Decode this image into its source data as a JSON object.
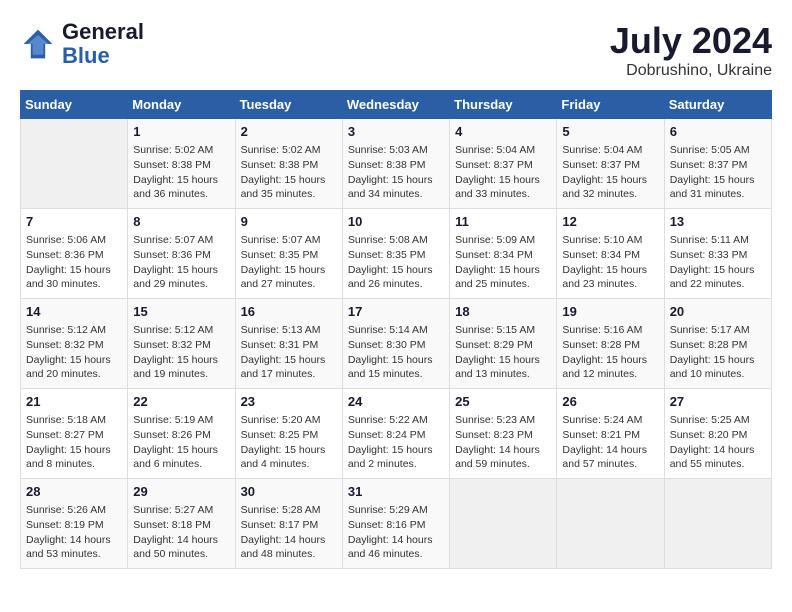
{
  "header": {
    "logo_line1": "General",
    "logo_line2": "Blue",
    "month_year": "July 2024",
    "location": "Dobrushino, Ukraine"
  },
  "days_of_week": [
    "Sunday",
    "Monday",
    "Tuesday",
    "Wednesday",
    "Thursday",
    "Friday",
    "Saturday"
  ],
  "weeks": [
    [
      {
        "day": "",
        "info": ""
      },
      {
        "day": "1",
        "info": "Sunrise: 5:02 AM\nSunset: 8:38 PM\nDaylight: 15 hours\nand 36 minutes."
      },
      {
        "day": "2",
        "info": "Sunrise: 5:02 AM\nSunset: 8:38 PM\nDaylight: 15 hours\nand 35 minutes."
      },
      {
        "day": "3",
        "info": "Sunrise: 5:03 AM\nSunset: 8:38 PM\nDaylight: 15 hours\nand 34 minutes."
      },
      {
        "day": "4",
        "info": "Sunrise: 5:04 AM\nSunset: 8:37 PM\nDaylight: 15 hours\nand 33 minutes."
      },
      {
        "day": "5",
        "info": "Sunrise: 5:04 AM\nSunset: 8:37 PM\nDaylight: 15 hours\nand 32 minutes."
      },
      {
        "day": "6",
        "info": "Sunrise: 5:05 AM\nSunset: 8:37 PM\nDaylight: 15 hours\nand 31 minutes."
      }
    ],
    [
      {
        "day": "7",
        "info": "Sunrise: 5:06 AM\nSunset: 8:36 PM\nDaylight: 15 hours\nand 30 minutes."
      },
      {
        "day": "8",
        "info": "Sunrise: 5:07 AM\nSunset: 8:36 PM\nDaylight: 15 hours\nand 29 minutes."
      },
      {
        "day": "9",
        "info": "Sunrise: 5:07 AM\nSunset: 8:35 PM\nDaylight: 15 hours\nand 27 minutes."
      },
      {
        "day": "10",
        "info": "Sunrise: 5:08 AM\nSunset: 8:35 PM\nDaylight: 15 hours\nand 26 minutes."
      },
      {
        "day": "11",
        "info": "Sunrise: 5:09 AM\nSunset: 8:34 PM\nDaylight: 15 hours\nand 25 minutes."
      },
      {
        "day": "12",
        "info": "Sunrise: 5:10 AM\nSunset: 8:34 PM\nDaylight: 15 hours\nand 23 minutes."
      },
      {
        "day": "13",
        "info": "Sunrise: 5:11 AM\nSunset: 8:33 PM\nDaylight: 15 hours\nand 22 minutes."
      }
    ],
    [
      {
        "day": "14",
        "info": "Sunrise: 5:12 AM\nSunset: 8:32 PM\nDaylight: 15 hours\nand 20 minutes."
      },
      {
        "day": "15",
        "info": "Sunrise: 5:12 AM\nSunset: 8:32 PM\nDaylight: 15 hours\nand 19 minutes."
      },
      {
        "day": "16",
        "info": "Sunrise: 5:13 AM\nSunset: 8:31 PM\nDaylight: 15 hours\nand 17 minutes."
      },
      {
        "day": "17",
        "info": "Sunrise: 5:14 AM\nSunset: 8:30 PM\nDaylight: 15 hours\nand 15 minutes."
      },
      {
        "day": "18",
        "info": "Sunrise: 5:15 AM\nSunset: 8:29 PM\nDaylight: 15 hours\nand 13 minutes."
      },
      {
        "day": "19",
        "info": "Sunrise: 5:16 AM\nSunset: 8:28 PM\nDaylight: 15 hours\nand 12 minutes."
      },
      {
        "day": "20",
        "info": "Sunrise: 5:17 AM\nSunset: 8:28 PM\nDaylight: 15 hours\nand 10 minutes."
      }
    ],
    [
      {
        "day": "21",
        "info": "Sunrise: 5:18 AM\nSunset: 8:27 PM\nDaylight: 15 hours\nand 8 minutes."
      },
      {
        "day": "22",
        "info": "Sunrise: 5:19 AM\nSunset: 8:26 PM\nDaylight: 15 hours\nand 6 minutes."
      },
      {
        "day": "23",
        "info": "Sunrise: 5:20 AM\nSunset: 8:25 PM\nDaylight: 15 hours\nand 4 minutes."
      },
      {
        "day": "24",
        "info": "Sunrise: 5:22 AM\nSunset: 8:24 PM\nDaylight: 15 hours\nand 2 minutes."
      },
      {
        "day": "25",
        "info": "Sunrise: 5:23 AM\nSunset: 8:23 PM\nDaylight: 14 hours\nand 59 minutes."
      },
      {
        "day": "26",
        "info": "Sunrise: 5:24 AM\nSunset: 8:21 PM\nDaylight: 14 hours\nand 57 minutes."
      },
      {
        "day": "27",
        "info": "Sunrise: 5:25 AM\nSunset: 8:20 PM\nDaylight: 14 hours\nand 55 minutes."
      }
    ],
    [
      {
        "day": "28",
        "info": "Sunrise: 5:26 AM\nSunset: 8:19 PM\nDaylight: 14 hours\nand 53 minutes."
      },
      {
        "day": "29",
        "info": "Sunrise: 5:27 AM\nSunset: 8:18 PM\nDaylight: 14 hours\nand 50 minutes."
      },
      {
        "day": "30",
        "info": "Sunrise: 5:28 AM\nSunset: 8:17 PM\nDaylight: 14 hours\nand 48 minutes."
      },
      {
        "day": "31",
        "info": "Sunrise: 5:29 AM\nSunset: 8:16 PM\nDaylight: 14 hours\nand 46 minutes."
      },
      {
        "day": "",
        "info": ""
      },
      {
        "day": "",
        "info": ""
      },
      {
        "day": "",
        "info": ""
      }
    ]
  ]
}
